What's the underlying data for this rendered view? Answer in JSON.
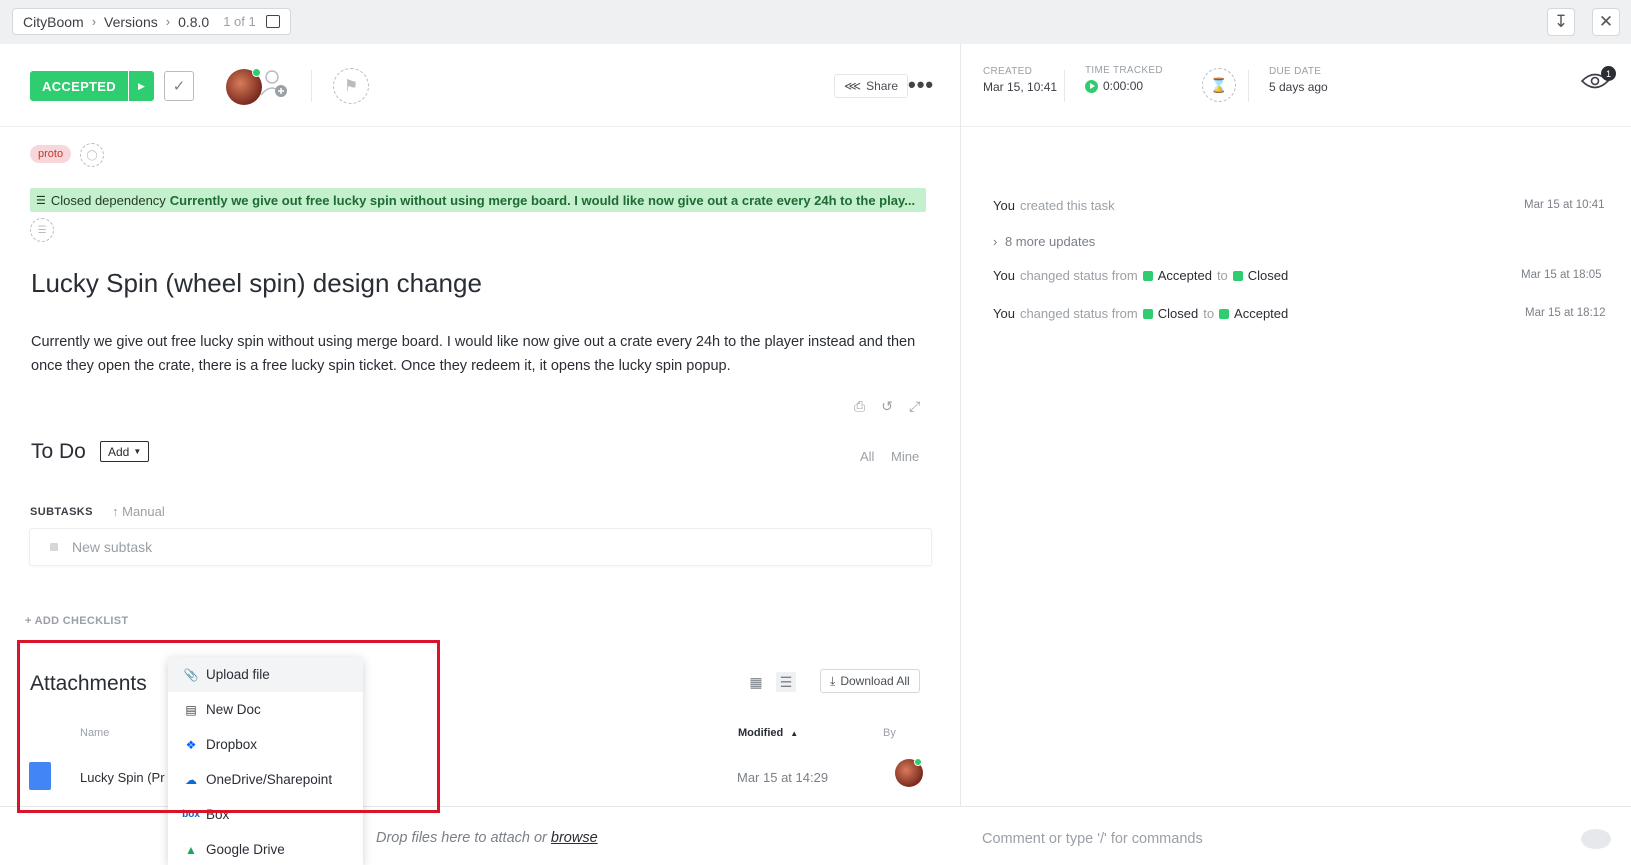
{
  "breadcrumb": {
    "workspace": "CityBoom",
    "folder": "Versions",
    "list": "0.8.0",
    "count": "1 of 1"
  },
  "task": {
    "status": "ACCEPTED",
    "share_label": "Share",
    "tag": "proto",
    "dependency_label": "Closed dependency",
    "dependency_text": "Currently we give out free lucky spin without using merge board. I would like now give out a crate every 24h to the play...",
    "title": "Lucky Spin (wheel spin) design change",
    "description": "Currently we give out free lucky spin without using merge board. I would like now give out a crate every 24h to the player instead and then once they open the crate, there is a free lucky spin ticket. Once they redeem it, it opens the lucky spin popup."
  },
  "meta": {
    "created_label": "CREATED",
    "created_value": "Mar 15, 10:41",
    "time_label": "TIME TRACKED",
    "time_value": "0:00:00",
    "due_label": "DUE DATE",
    "due_value": "5 days ago",
    "watchers": "1"
  },
  "todo": {
    "title": "To Do",
    "add_label": "Add",
    "filter_all": "All",
    "filter_mine": "Mine",
    "subtasks_label": "SUBTASKS",
    "sort_label": "Manual",
    "new_subtask_placeholder": "New subtask",
    "add_checklist": "+ ADD CHECKLIST"
  },
  "attachments": {
    "title": "Attachments",
    "download_all": "Download All",
    "col_name": "Name",
    "col_modified": "Modified",
    "col_by": "By",
    "rows": [
      {
        "name": "Lucky Spin (Pr",
        "modified": "Mar 15 at 14:29"
      }
    ]
  },
  "upload_menu": {
    "items": [
      {
        "label": "Upload file",
        "icon": "paperclip-icon"
      },
      {
        "label": "New Doc",
        "icon": "doc-icon"
      },
      {
        "label": "Dropbox",
        "icon": "dropbox-icon"
      },
      {
        "label": "OneDrive/Sharepoint",
        "icon": "onedrive-icon"
      },
      {
        "label": "Box",
        "icon": "box-icon"
      },
      {
        "label": "Google Drive",
        "icon": "google-drive-icon"
      }
    ]
  },
  "dropzone": {
    "text": "Drop files here to attach or",
    "link": "browse"
  },
  "comment": {
    "placeholder": "Comment or type '/' for commands"
  },
  "activity": {
    "created": {
      "who": "You",
      "what": "created this task",
      "time": "Mar 15 at 10:41"
    },
    "more": "8 more updates",
    "change1": {
      "who": "You",
      "what": "changed status from",
      "from": "Accepted",
      "to_word": "to",
      "to": "Closed",
      "time": "Mar 15 at 18:05"
    },
    "change2": {
      "who": "You",
      "what": "changed status from",
      "from": "Closed",
      "to_word": "to",
      "to": "Accepted",
      "time": "Mar 15 at 18:12"
    }
  },
  "colors": {
    "status_green": "#2ecd6f",
    "highlight_red": "#d9132a",
    "dependency_bg": "#c5f0cd",
    "tag_bg": "#f8d7da"
  }
}
